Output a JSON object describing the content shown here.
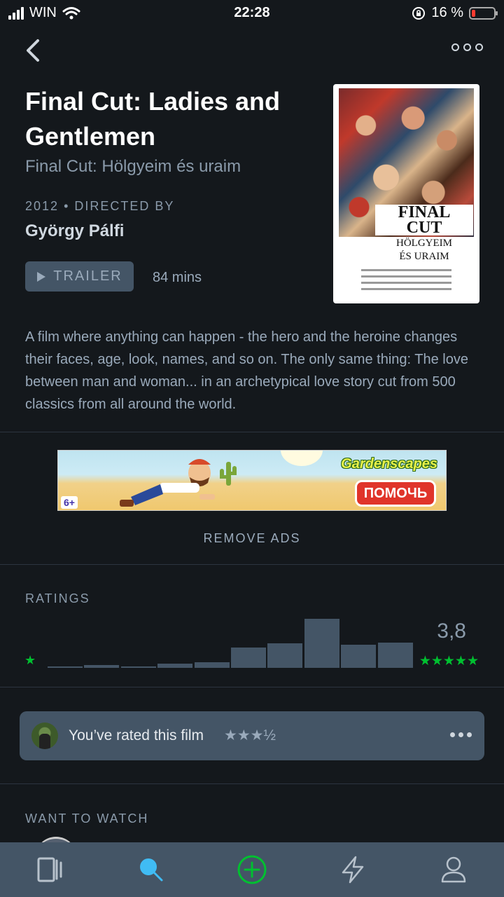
{
  "status_bar": {
    "carrier": "WIN",
    "time": "22:28",
    "battery_percent": "16 %",
    "battery_level": 0.16
  },
  "film": {
    "title": "Final Cut: Ladies and Gentlemen",
    "original_title": "Final Cut: Hölgyeim és uraim",
    "year": "2012",
    "directed_by_label": "DIRECTED BY",
    "director": "György Pálfi",
    "trailer_label": "TRAILER",
    "runtime": "84 mins",
    "synopsis": "A film where anything can happen - the hero and the heroine changes their faces, age, look, names, and so on. The only same thing: The love between man and woman... in an archetypical love story cut from 500 classics from all around the world."
  },
  "poster": {
    "title_line1": "FINAL",
    "title_line2": "CUT",
    "subtitle_line1": "HÖLGYEIM",
    "subtitle_line2": "ÉS URAIM"
  },
  "ad": {
    "brand": "Gardenscapes",
    "cta": "ПОМОЧЬ",
    "age_rating": "6+",
    "remove_ads_label": "REMOVE ADS"
  },
  "ratings": {
    "heading": "RATINGS",
    "min_star": "★",
    "average": "3,8",
    "max_stars": "★★★★★",
    "histogram": [
      0.02,
      0.05,
      0.03,
      0.08,
      0.12,
      0.42,
      0.5,
      1.0,
      0.47,
      0.52
    ]
  },
  "user_rating": {
    "text": "You’ve rated this film",
    "stars": "★★★½"
  },
  "want_to_watch": {
    "heading": "WANT TO WATCH"
  },
  "colors": {
    "background": "#14181c",
    "panel": "#445566",
    "accent_green": "#00c030",
    "accent_blue": "#40bcf4",
    "muted_text": "#9aaabb"
  },
  "tabs": [
    {
      "icon": "films-icon",
      "active": false
    },
    {
      "icon": "search-icon",
      "active": true
    },
    {
      "icon": "add-icon",
      "active": false
    },
    {
      "icon": "activity-icon",
      "active": false
    },
    {
      "icon": "profile-icon",
      "active": false
    }
  ]
}
